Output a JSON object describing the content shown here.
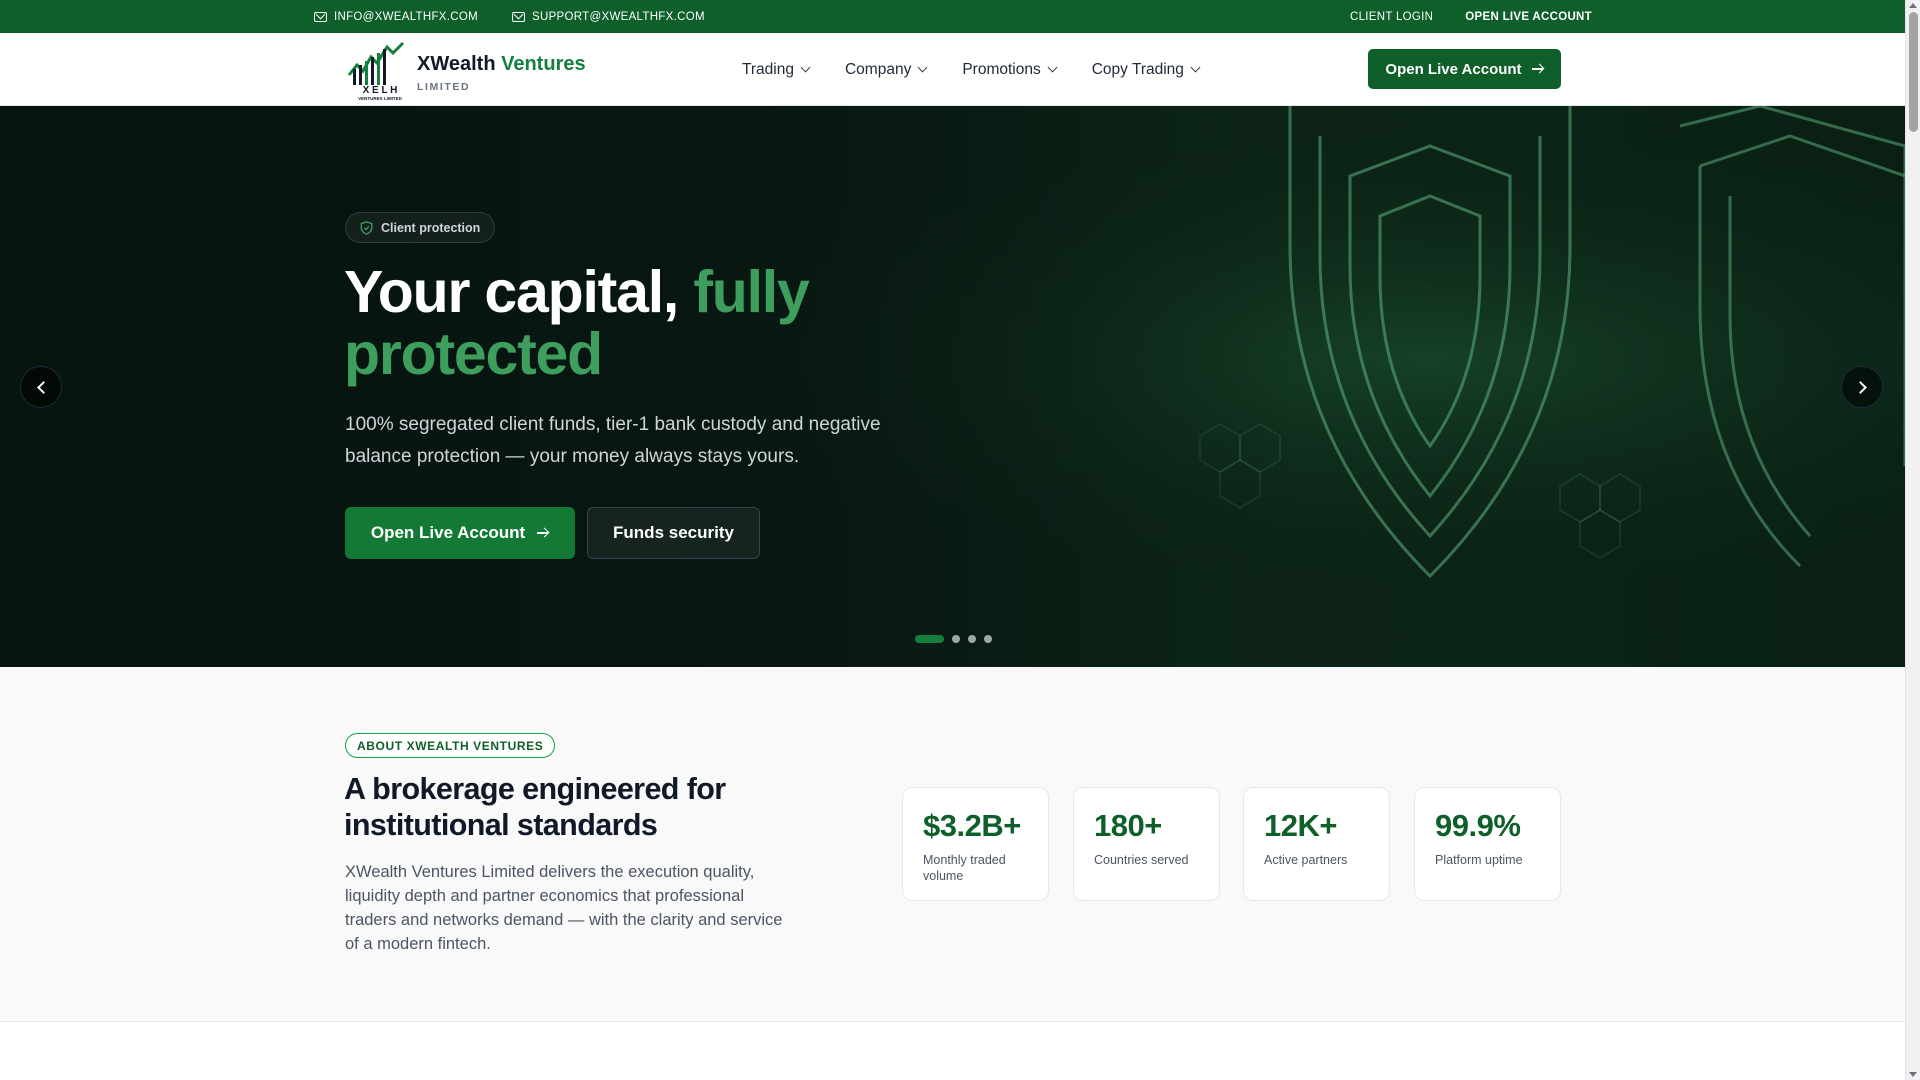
{
  "topbar": {
    "email_info": "INFO@XWEALTHFX.COM",
    "email_support": "SUPPORT@XWEALTHFX.COM",
    "client_login": "CLIENT LOGIN",
    "open_live": "OPEN LIVE ACCOUNT",
    "icon": "mail-icon"
  },
  "brand": {
    "name_primary": "XWealth",
    "name_accent": "Ventures",
    "sub": "LIMITED",
    "mark_letters": "X E L H",
    "mark_tagline": "VENTURES LIMITED"
  },
  "nav": {
    "items": [
      {
        "label": "Trading"
      },
      {
        "label": "Company"
      },
      {
        "label": "Promotions"
      },
      {
        "label": "Copy Trading"
      }
    ],
    "cta": "Open Live Account"
  },
  "hero": {
    "badge": "Client protection",
    "title_plain": "Your capital, ",
    "title_highlight": "fully protected",
    "description": "100% segregated client funds, tier-1 bank custody and negative balance protection — your money always stays yours.",
    "primary_button": "Open Live Account",
    "secondary_button": "Funds security",
    "slides_total": 4,
    "slide_active": 1
  },
  "about": {
    "tag": "ABOUT XWEALTH VENTURES",
    "title": "A brokerage engineered for institutional standards",
    "text": "XWealth Ventures Limited delivers the execution quality, liquidity depth and partner economics that professional traders and networks demand — with the clarity and service of a modern fintech.",
    "stats": [
      {
        "value": "$3.2B+",
        "label": "Monthly traded volume"
      },
      {
        "value": "180+",
        "label": "Countries served"
      },
      {
        "value": "12K+",
        "label": "Active partners"
      },
      {
        "value": "99.9%",
        "label": "Platform uptime"
      }
    ]
  },
  "colors": {
    "brand_green": "#0f5f2a",
    "accent_green": "#3e9e5e",
    "hero_bg": "#071510"
  }
}
